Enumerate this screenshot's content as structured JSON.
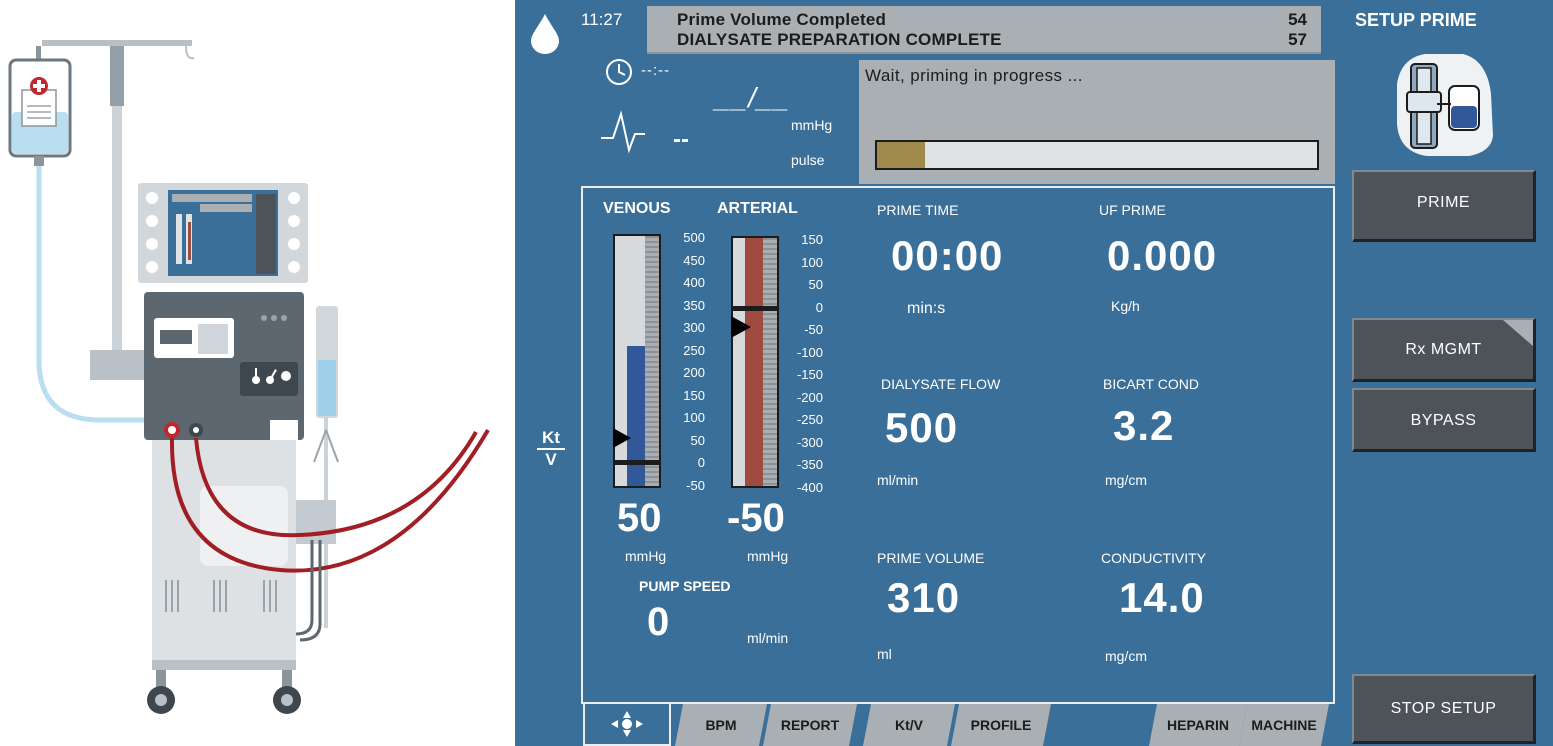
{
  "header": {
    "time": "11:27",
    "messages": [
      {
        "text": "Prime Volume Completed",
        "code": "54"
      },
      {
        "text": "DIALYSATE PREPARATION COMPLETE",
        "code": "57"
      }
    ]
  },
  "status": {
    "text": "Wait, priming in progress ...",
    "progress_fraction": 0.11
  },
  "vitals": {
    "timer": "--:--",
    "bp_value": "__/__",
    "bp_unit": "mmHg",
    "pulse_value": "--",
    "pulse_unit": "pulse"
  },
  "pressure": {
    "venous": {
      "label": "VENOUS",
      "scale": [
        "500",
        "450",
        "400",
        "350",
        "300",
        "250",
        "200",
        "150",
        "100",
        "50",
        "0",
        "-50"
      ],
      "value": "50",
      "unit": "mmHg"
    },
    "arterial": {
      "label": "ARTERIAL",
      "scale": [
        "150",
        "100",
        "50",
        "0",
        "-50",
        "-100",
        "-150",
        "-200",
        "-250",
        "-300",
        "-350",
        "-400"
      ],
      "value": "-50",
      "unit": "mmHg"
    }
  },
  "pump": {
    "label": "PUMP SPEED",
    "value": "0",
    "unit": "ml/min"
  },
  "metrics": {
    "prime_time": {
      "label": "PRIME TIME",
      "value": "00:00",
      "unit": "min:s"
    },
    "uf_prime": {
      "label": "UF PRIME",
      "value": "0.000",
      "unit": "Kg/h"
    },
    "dialysate_flow": {
      "label": "DIALYSATE FLOW",
      "value": "500",
      "unit": "ml/min"
    },
    "bicart_cond": {
      "label": "BICART COND",
      "value": "3.2",
      "unit": "mg/cm"
    },
    "prime_volume": {
      "label": "PRIME VOLUME",
      "value": "310",
      "unit": "ml"
    },
    "conductivity": {
      "label": "CONDUCTIVITY",
      "value": "14.0",
      "unit": "mg/cm"
    }
  },
  "ktv": {
    "top": "Kt",
    "bottom": "V"
  },
  "tabs": [
    "BPM",
    "REPORT",
    "Kt/V",
    "PROFILE",
    "HEPARIN",
    "MACHINE"
  ],
  "right_panel": {
    "title": "SETUP PRIME",
    "buttons": {
      "prime": "PRIME",
      "rx_mgmt": "Rx MGMT",
      "bypass": "BYPASS",
      "stop_setup": "STOP SETUP"
    }
  },
  "colors": {
    "screen_bg": "#3a6f99",
    "message_bg": "#a9afb3",
    "progress_fill": "#a08a4b",
    "venous_bar": "#33589a",
    "arterial_bar": "#a04a40",
    "button_bg": "#4d5359"
  }
}
